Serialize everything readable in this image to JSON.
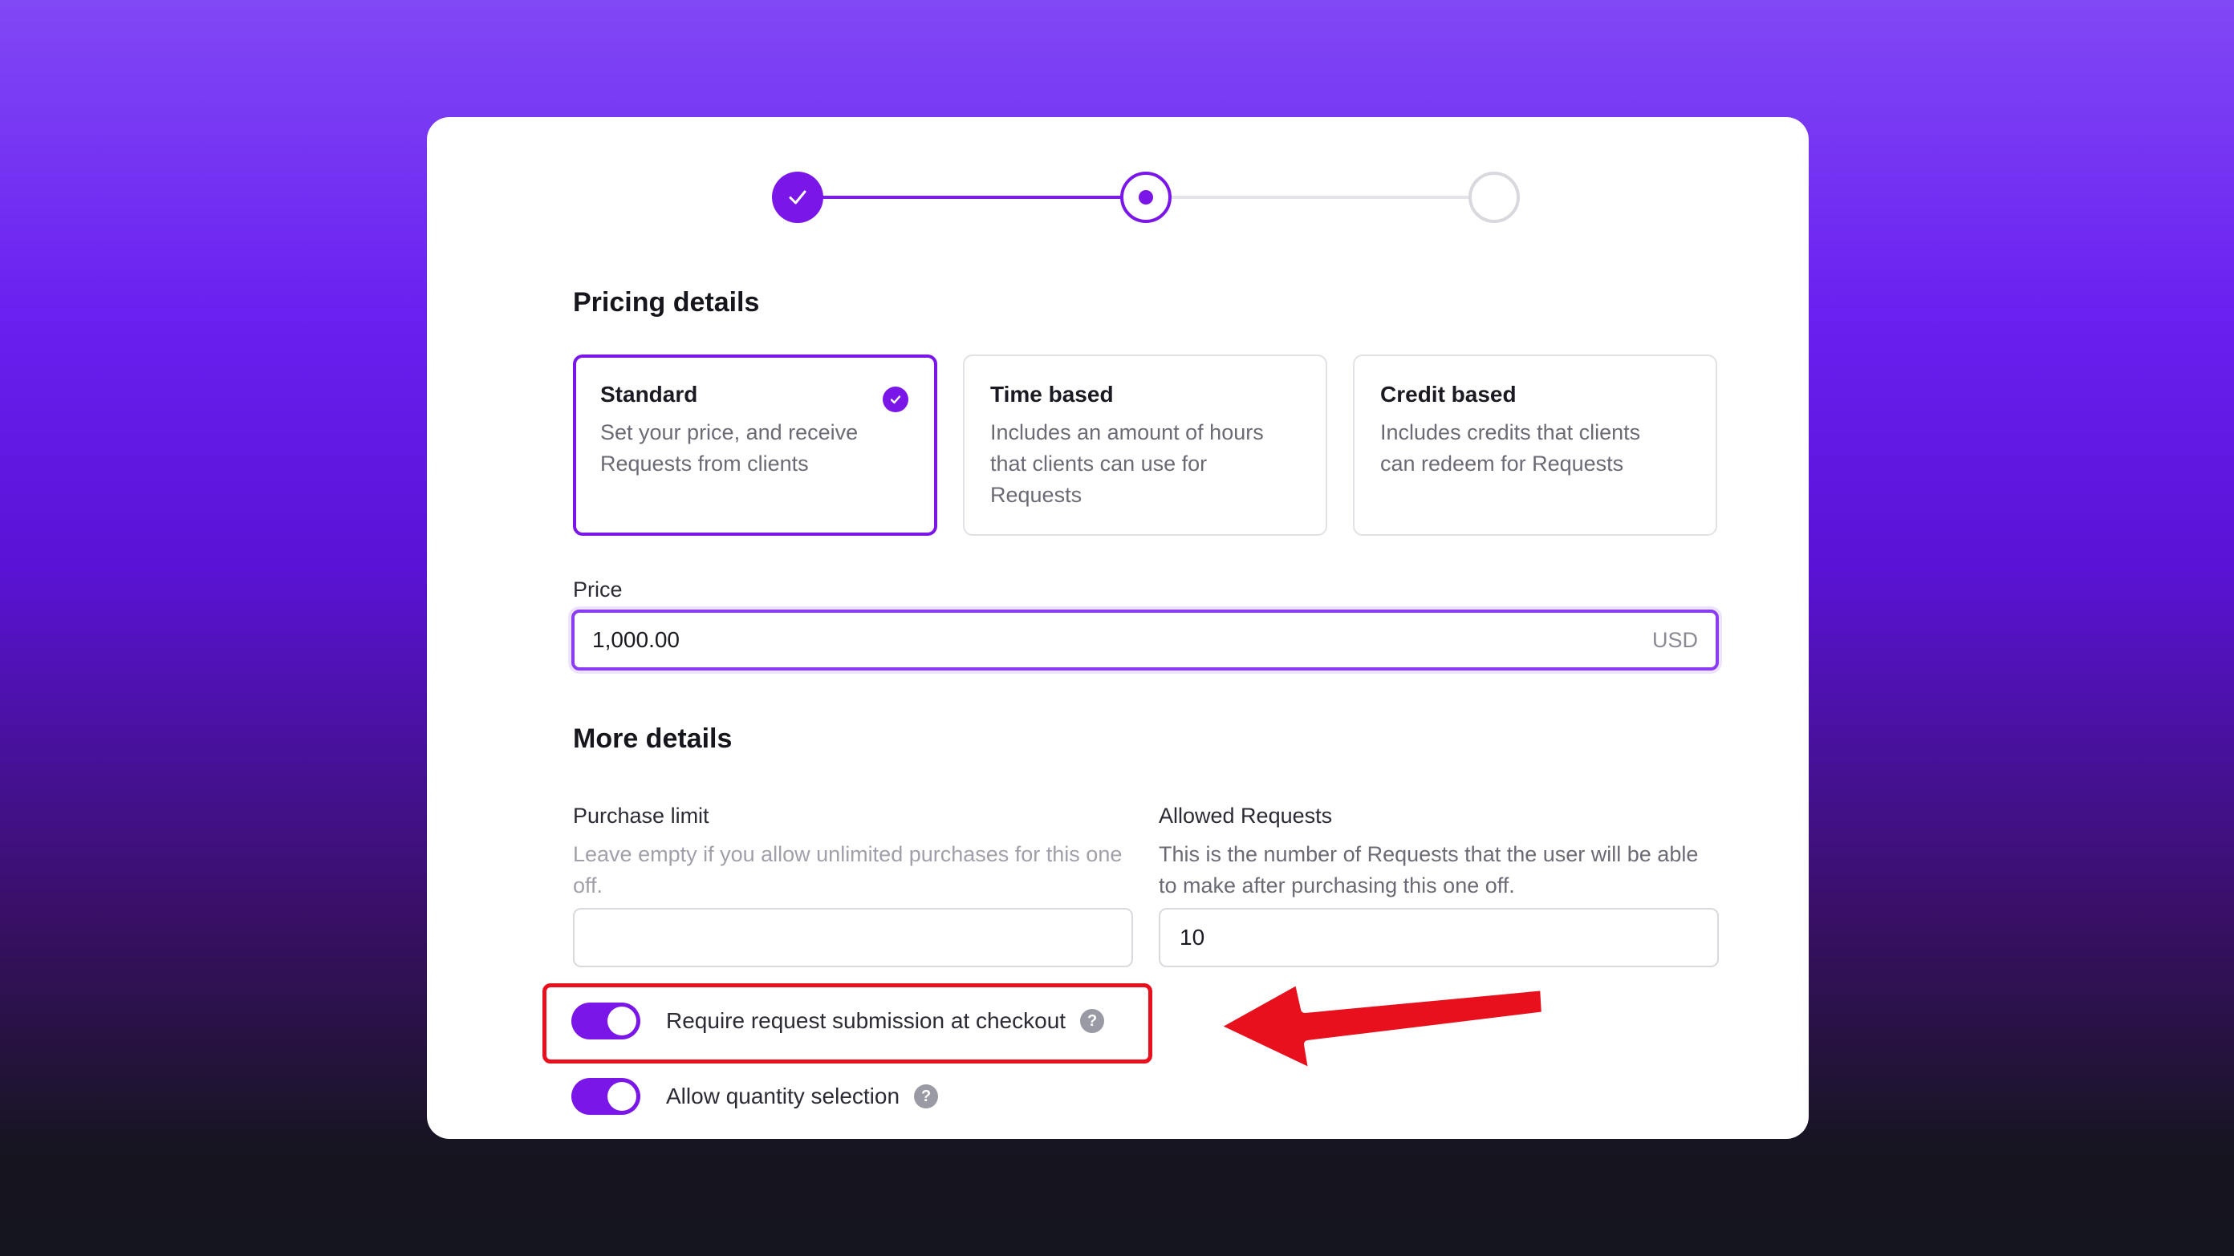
{
  "stepper": {
    "steps": [
      "completed",
      "current",
      "upcoming"
    ]
  },
  "pricing": {
    "title": "Pricing details",
    "options": [
      {
        "title": "Standard",
        "description": "Set your price, and receive Requests from clients",
        "selected": true
      },
      {
        "title": "Time based",
        "description": "Includes an amount of hours that clients can use for Requests",
        "selected": false
      },
      {
        "title": "Credit based",
        "description": "Includes credits that clients can redeem for Requests",
        "selected": false
      }
    ],
    "price_label": "Price",
    "price_value": "1,000.00",
    "price_currency": "USD"
  },
  "more": {
    "title": "More details",
    "purchase_limit": {
      "label": "Purchase limit",
      "help": "Leave empty if you allow unlimited purchases for this one off.",
      "value": ""
    },
    "allowed_requests": {
      "label": "Allowed Requests",
      "help": "This is the number of Requests that the user will be able to make after purchasing this one off.",
      "value": "10"
    },
    "toggles": [
      {
        "label": "Require request submission at checkout",
        "on": true,
        "help_icon": "?"
      },
      {
        "label": "Allow quantity selection",
        "on": true,
        "help_icon": "?"
      }
    ]
  },
  "colors": {
    "accent": "#7a16e8",
    "annotation": "#e8101c"
  }
}
